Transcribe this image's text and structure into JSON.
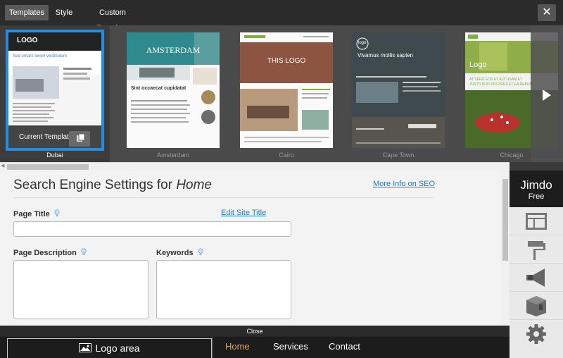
{
  "topbar": {
    "tabs": [
      {
        "label": "Templates",
        "active": true
      },
      {
        "label": "Style",
        "active": false
      },
      {
        "label": "Custom Template",
        "active": false
      }
    ],
    "close_symbol": "✕"
  },
  "templates": {
    "items": [
      {
        "name": "Dubai",
        "selected": true,
        "overlay_label": "Current Template"
      },
      {
        "name": "Amsterdam",
        "selected": false
      },
      {
        "name": "Cairo",
        "selected": false
      },
      {
        "name": "Cape Town",
        "selected": false
      },
      {
        "name": "Chicago",
        "selected": false
      }
    ],
    "thumb_text": {
      "dubai_logo": "LOGO",
      "dubai_heading": "Sed ornare lorem vestibulum",
      "amsterdam_title": "AMSTERDAM",
      "amsterdam_heading": "Sint occaecat cupidatat",
      "cairo_logo": "THIS LOGO",
      "cape_town_logo": "logo",
      "cape_town_heading": "Vivamus mollis sapien",
      "chicago_logo": "Logo",
      "chicago_heading": "AT VERO EOS ET ACCUSAM ET JUSTO DUO DOLORES ET EA REBUM"
    }
  },
  "seo": {
    "title_prefix": "Search Engine Settings for ",
    "title_page": "Home",
    "more_info": "More Info on SEO",
    "page_title_label": "Page Title",
    "edit_site_title": "Edit Site Title",
    "page_description_label": "Page Description",
    "keywords_label": "Keywords",
    "page_title_value": "",
    "page_description_value": "",
    "keywords_value": ""
  },
  "close_bar": {
    "label": "Close"
  },
  "site_preview": {
    "logo_area": "Logo area",
    "nav": [
      {
        "label": "Home",
        "active": true
      },
      {
        "label": "Services",
        "active": false
      },
      {
        "label": "Contact",
        "active": false
      }
    ]
  },
  "sidebar": {
    "brand": "Jimdo",
    "plan": "Free",
    "items": [
      {
        "icon": "layout-icon"
      },
      {
        "icon": "paint-roller-icon"
      },
      {
        "icon": "megaphone-icon"
      },
      {
        "icon": "package-icon"
      },
      {
        "icon": "gear-icon"
      }
    ]
  },
  "colors": {
    "accent_blue": "#1e8ee6",
    "link_blue": "#1a7bc9",
    "nav_active": "#e8a23b",
    "topbar": "#2b2b2b"
  }
}
